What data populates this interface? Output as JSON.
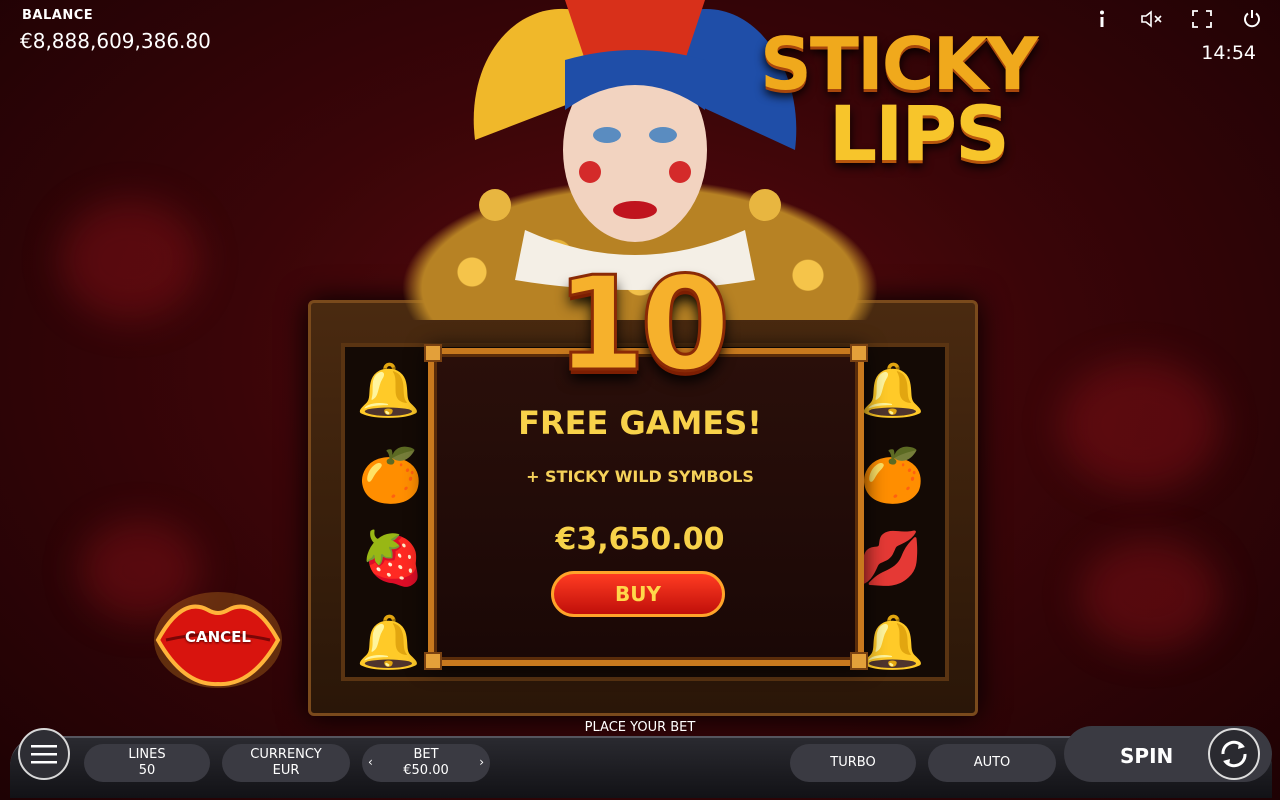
{
  "balance": {
    "label": "BALANCE",
    "value": "€8,888,609,386.80"
  },
  "clock": "14:54",
  "top_icons": [
    "info-icon",
    "sound-muted-icon",
    "fullscreen-icon",
    "power-icon"
  ],
  "logo": {
    "line1": "STICKY",
    "line2": "LIPS"
  },
  "popup": {
    "number": "10",
    "title": "FREE GAMES!",
    "subtitle": "+ STICKY WILD SYMBOLS",
    "price": "€3,650.00",
    "buy_label": "BUY"
  },
  "cancel_label": "CANCEL",
  "bottom": {
    "place_bet": "PLACE YOUR BET",
    "lines": {
      "label": "LINES",
      "value": "50"
    },
    "currency": {
      "label": "CURRENCY",
      "value": "EUR"
    },
    "bet": {
      "label": "BET",
      "value": "€50.00"
    },
    "turbo": "TURBO",
    "auto": "AUTO",
    "spin": "SPIN"
  },
  "colors": {
    "gold": "#f8d24a",
    "buy_red": "#e0160f",
    "background": "#3a0508"
  }
}
